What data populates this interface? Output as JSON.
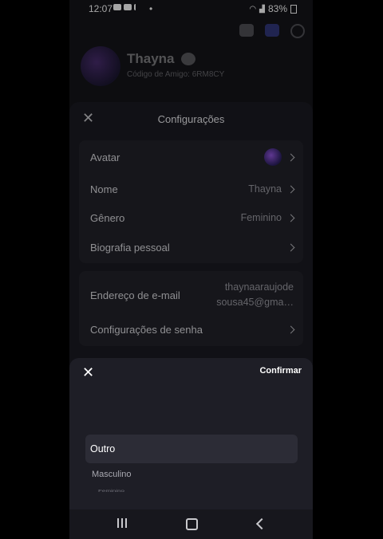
{
  "status": {
    "time": "12:07",
    "dot": "•",
    "battery": "83%"
  },
  "profile": {
    "name": "Thayna",
    "code": "Código de Amigo: 6RM8CY"
  },
  "settings": {
    "title": "Configurações",
    "avatar_label": "Avatar",
    "name_label": "Nome",
    "name_value": "Thayna",
    "gender_label": "Gênero",
    "gender_value": "Feminino",
    "bio_label": "Biografia pessoal",
    "email_label": "Endereço de e-mail",
    "email_line1": "thaynaaraujode",
    "email_line2": "sousa45@gma…",
    "password_label": "Configurações de senha"
  },
  "picker": {
    "confirm": "Confirmar",
    "selected": "Outro",
    "option2": "Masculino",
    "option3": "Feminino"
  },
  "colors": {
    "accent": "#5865f2",
    "sheet": "#1b1b22"
  }
}
